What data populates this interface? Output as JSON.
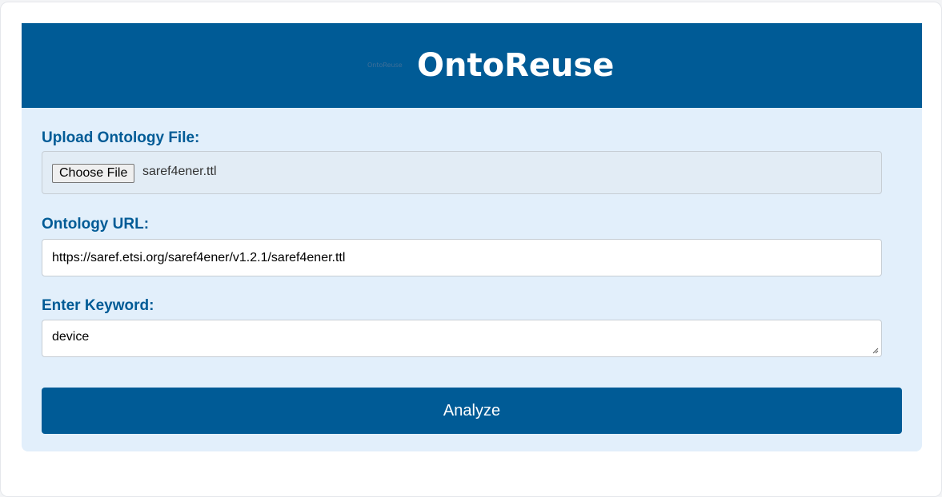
{
  "header": {
    "logo_text": "OntoReuse",
    "title": "OntoReuse"
  },
  "form": {
    "upload_label": "Upload Ontology File:",
    "choose_file_label": "Choose File",
    "file_name": "saref4ener.ttl",
    "url_label": "Ontology URL:",
    "url_value": "https://saref.etsi.org/saref4ener/v1.2.1/saref4ener.ttl",
    "keyword_label": "Enter Keyword:",
    "keyword_value": "device",
    "analyze_label": "Analyze"
  },
  "colors": {
    "brand": "#005b96",
    "card_background": "#e2effb"
  }
}
